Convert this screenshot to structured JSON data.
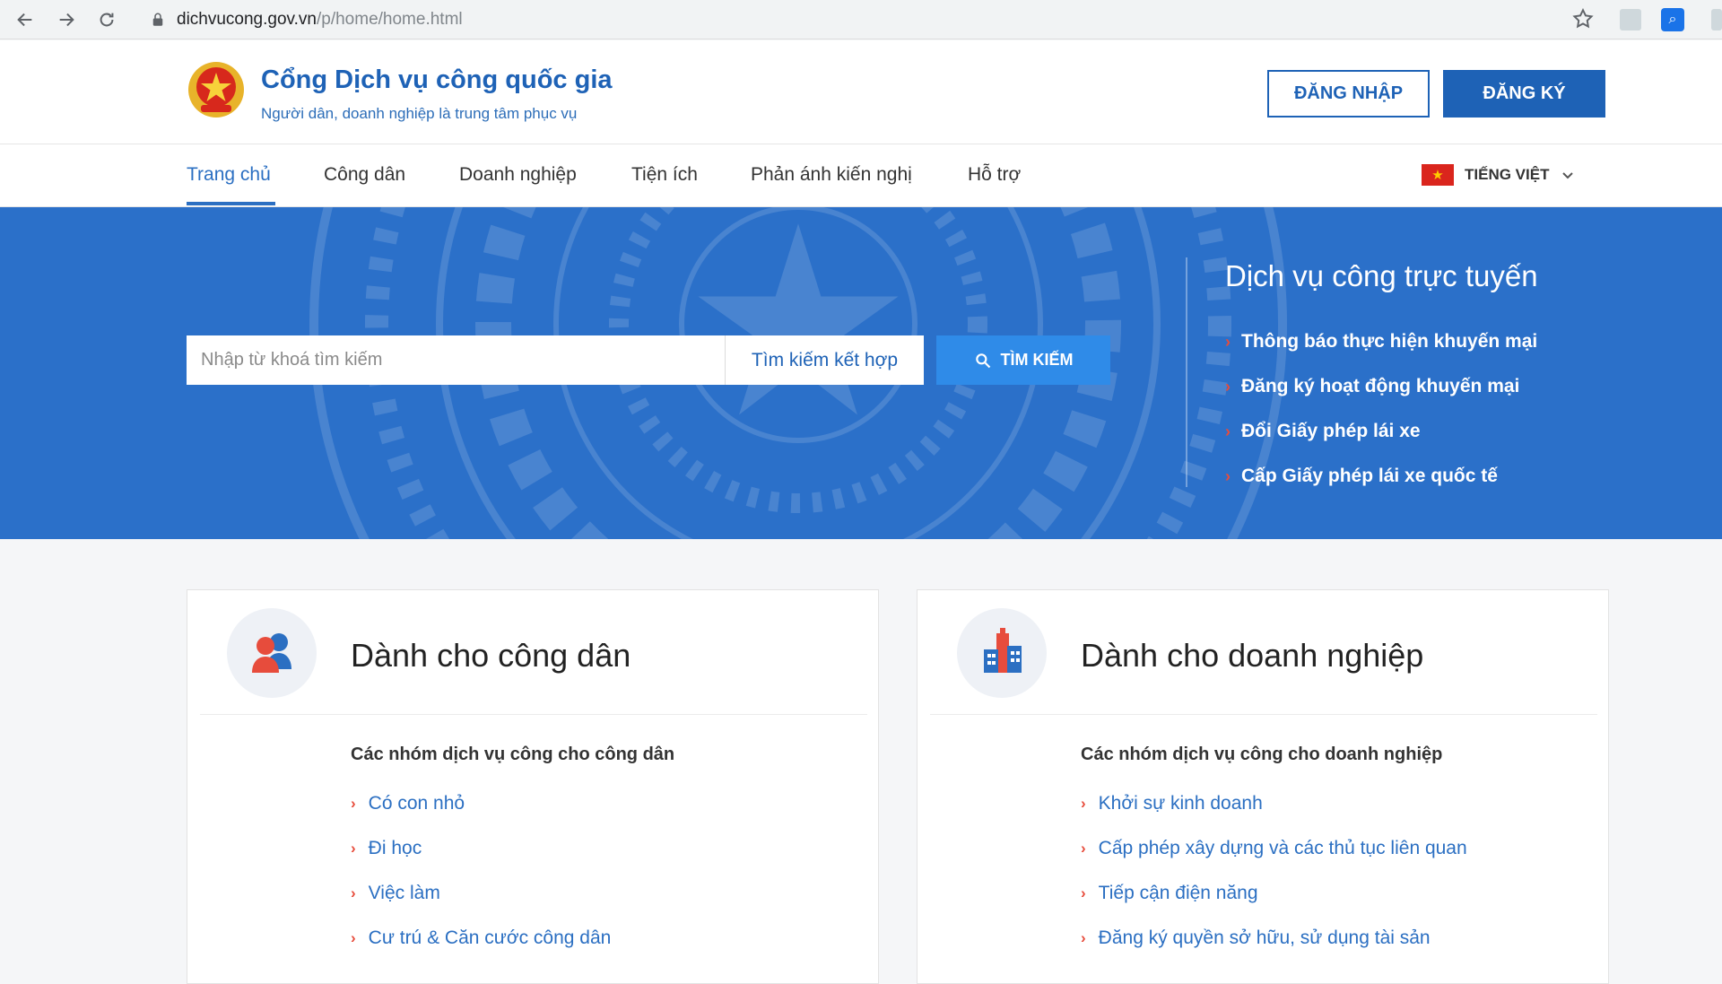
{
  "browser": {
    "url_domain": "dichvucong.gov.vn",
    "url_path": "/p/home/home.html"
  },
  "header": {
    "title": "Cổng Dịch vụ công quốc gia",
    "subtitle": "Người dân, doanh nghiệp là trung tâm phục vụ",
    "login_label": "ĐĂNG NHẬP",
    "register_label": "ĐĂNG KÝ"
  },
  "nav": {
    "items": [
      {
        "label": "Trang chủ",
        "active": true
      },
      {
        "label": "Công dân"
      },
      {
        "label": "Doanh nghiệp"
      },
      {
        "label": "Tiện ích"
      },
      {
        "label": "Phản ánh kiến nghị"
      },
      {
        "label": "Hỗ trợ"
      }
    ],
    "language": "TIẾNG VIỆT"
  },
  "hero": {
    "search_placeholder": "Nhập từ khoá tìm kiếm",
    "advanced_search": "Tìm kiếm kết hợp",
    "search_button": "TÌM KIẾM",
    "online_title": "Dịch vụ công trực tuyến",
    "online_links": [
      "Thông báo thực hiện khuyến mại",
      "Đăng ký hoạt động khuyến mại",
      "Đổi Giấy phép lái xe",
      "Cấp Giấy phép lái xe quốc tế"
    ]
  },
  "cards": {
    "citizen": {
      "title": "Dành cho công dân",
      "group": "Các nhóm dịch vụ công cho công dân",
      "items": [
        "Có con nhỏ",
        "Đi học",
        "Việc làm",
        "Cư trú & Căn cước công dân"
      ]
    },
    "business": {
      "title": "Dành cho doanh nghiệp",
      "group": "Các nhóm dịch vụ công cho doanh nghiệp",
      "items": [
        "Khởi sự kinh doanh",
        "Cấp phép xây dựng và các thủ tục liên quan",
        "Tiếp cận điện năng",
        "Đăng ký quyền sở hữu, sử dụng tài sản"
      ]
    }
  },
  "colors": {
    "brand_blue": "#1e62b6",
    "hero_blue": "#2b70c9",
    "accent_red": "#e74c3c"
  }
}
